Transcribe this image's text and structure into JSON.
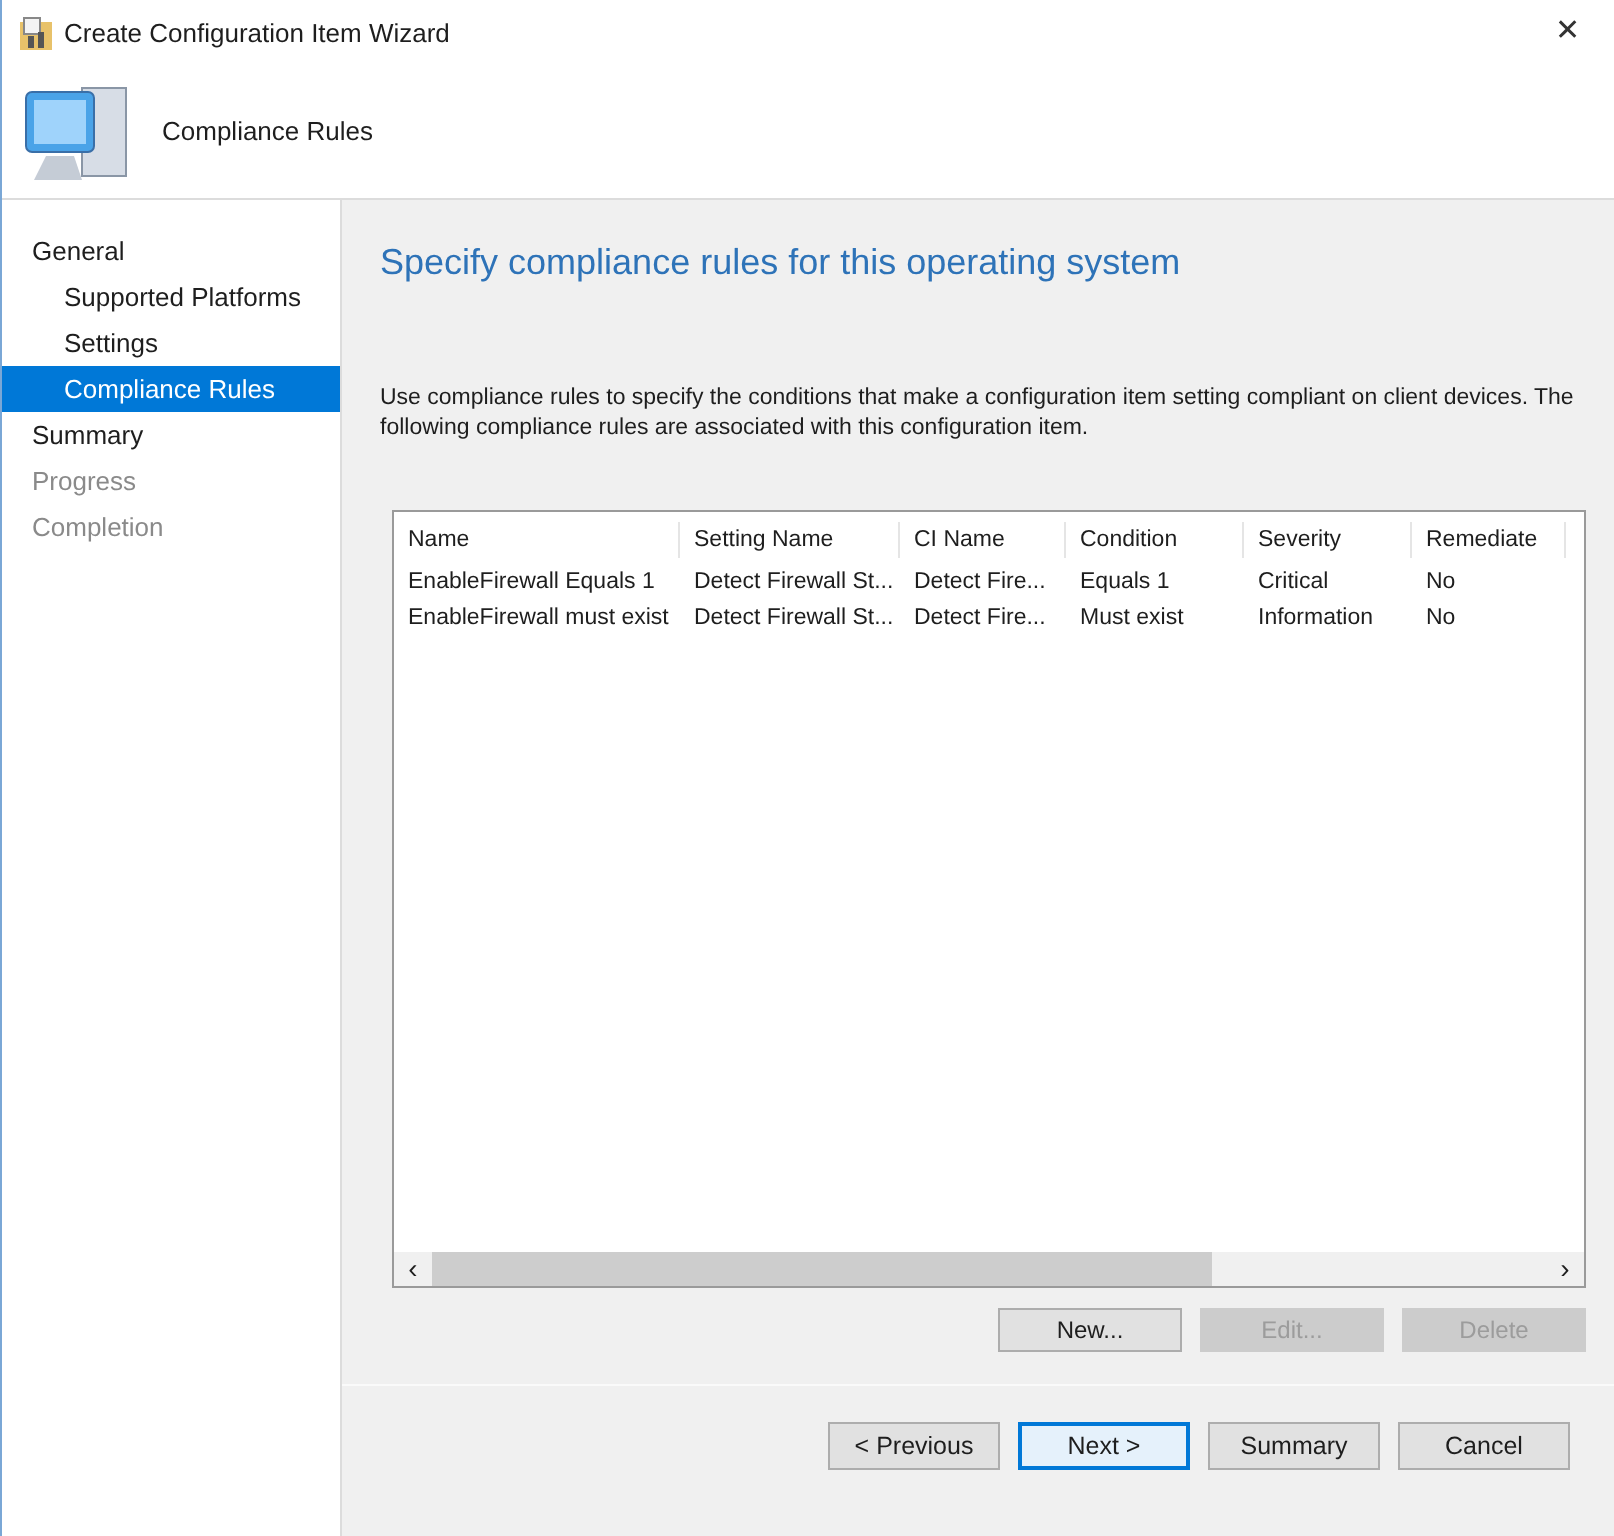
{
  "window": {
    "title": "Create Configuration Item Wizard",
    "close": "✕"
  },
  "header": {
    "title": "Compliance Rules"
  },
  "nav": [
    {
      "label": "General",
      "selected": false,
      "disabled": false,
      "children": [
        {
          "label": "Supported Platforms",
          "selected": false,
          "disabled": false
        },
        {
          "label": "Settings",
          "selected": false,
          "disabled": false
        },
        {
          "label": "Compliance Rules",
          "selected": true,
          "disabled": false
        }
      ]
    },
    {
      "label": "Summary",
      "selected": false,
      "disabled": false
    },
    {
      "label": "Progress",
      "selected": false,
      "disabled": true
    },
    {
      "label": "Completion",
      "selected": false,
      "disabled": true
    }
  ],
  "page": {
    "heading": "Specify compliance rules for this operating system",
    "description": "Use compliance rules to specify the conditions that make a configuration item setting compliant on client devices. The following compliance rules are associated with this configuration item."
  },
  "table": {
    "columns": [
      "Name",
      "Setting Name",
      "CI Name",
      "Condition",
      "Severity",
      "Remediate"
    ],
    "rows": [
      [
        "EnableFirewall Equals 1",
        "Detect Firewall St...",
        "Detect Fire...",
        "Equals 1",
        "Critical",
        "No"
      ],
      [
        "EnableFirewall must exist",
        "Detect Firewall St...",
        "Detect Fire...",
        "Must exist",
        "Information",
        "No"
      ]
    ],
    "scroll_left": "‹",
    "scroll_right": "›"
  },
  "table_buttons": [
    {
      "label": "New...",
      "disabled": false
    },
    {
      "label": "Edit...",
      "disabled": true
    },
    {
      "label": "Delete",
      "disabled": true
    }
  ],
  "footer_buttons": [
    {
      "label": "< Previous",
      "default": false
    },
    {
      "label": "Next >",
      "default": true
    },
    {
      "label": "Summary",
      "default": false
    },
    {
      "label": "Cancel",
      "default": false
    }
  ]
}
